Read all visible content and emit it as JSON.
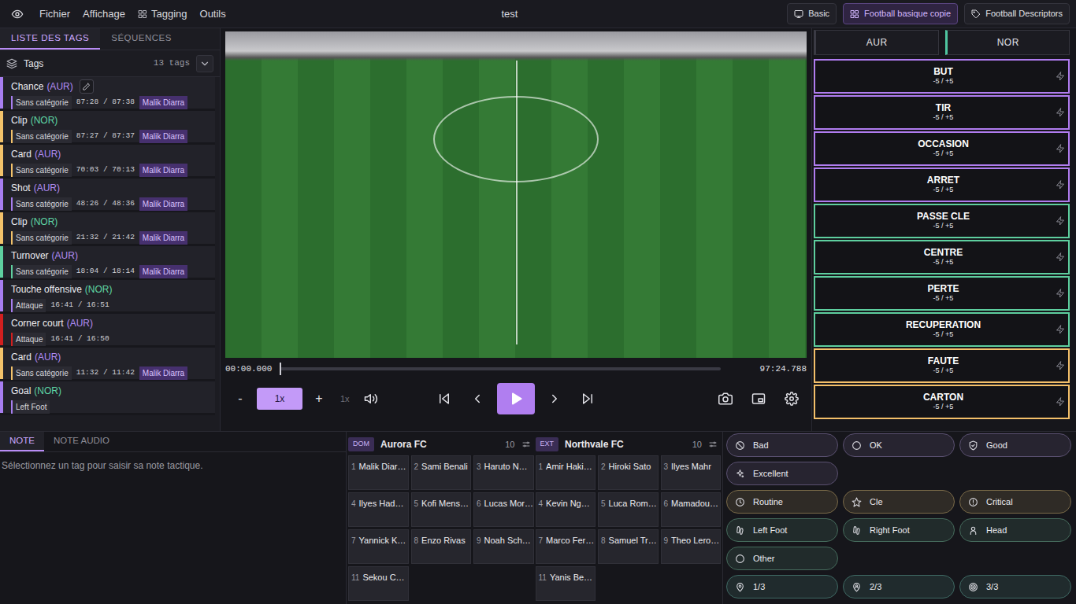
{
  "menubar": {
    "items": [
      {
        "label": "Fichier",
        "kind": "plain"
      },
      {
        "label": "Affichage",
        "kind": "plain"
      },
      {
        "label": "Tagging",
        "kind": "grid"
      },
      {
        "label": "Outils",
        "kind": "plain"
      }
    ],
    "title": "test",
    "templates": [
      {
        "label": "Basic",
        "kind": "monitor",
        "selected": false
      },
      {
        "label": "Football basique copie",
        "kind": "grid",
        "selected": true
      },
      {
        "label": "Football Descriptors",
        "kind": "tag",
        "selected": false
      }
    ]
  },
  "left_panel": {
    "tabs": [
      {
        "label": "LISTE DES TAGS",
        "selected": true
      },
      {
        "label": "SÉQUENCES",
        "selected": false
      }
    ],
    "header": {
      "title": "Tags",
      "count": "13 tags"
    },
    "tags": [
      {
        "name": "Chance",
        "team": "(AUR)",
        "team_color": "#b18cf5",
        "color": "#a77ef0",
        "editing": true,
        "category": "Sans catégorie",
        "time": "87:28 / 87:38",
        "player": "Malik Diarra"
      },
      {
        "name": "Clip",
        "team": "(NOR)",
        "team_color": "#5fd6a4",
        "color": "#f2c26a",
        "editing": false,
        "category": "Sans catégorie",
        "time": "87:27 / 87:37",
        "player": "Malik Diarra"
      },
      {
        "name": "Card",
        "team": "(AUR)",
        "team_color": "#b18cf5",
        "color": "#f2c26a",
        "editing": false,
        "category": "Sans catégorie",
        "time": "70:03 / 70:13",
        "player": "Malik Diarra"
      },
      {
        "name": "Shot",
        "team": "(AUR)",
        "team_color": "#b18cf5",
        "color": "#a77ef0",
        "editing": false,
        "category": "Sans catégorie",
        "time": "48:26 / 48:36",
        "player": "Malik Diarra"
      },
      {
        "name": "Clip",
        "team": "(NOR)",
        "team_color": "#5fd6a4",
        "color": "#f2c26a",
        "editing": false,
        "category": "Sans catégorie",
        "time": "21:32 / 21:42",
        "player": "Malik Diarra"
      },
      {
        "name": "Turnover",
        "team": "(AUR)",
        "team_color": "#b18cf5",
        "color": "#5ecf9f",
        "editing": false,
        "category": "Sans catégorie",
        "time": "18:04 / 18:14",
        "player": "Malik Diarra"
      },
      {
        "name": "Touche offensive",
        "team": "(NOR)",
        "team_color": "#5fd6a4",
        "color": "#a77ef0",
        "editing": false,
        "category": "Attaque",
        "time": "16:41 / 16:51"
      },
      {
        "name": "Corner court",
        "team": "(AUR)",
        "team_color": "#b18cf5",
        "color": "#d11f1f",
        "editing": false,
        "category": "Attaque",
        "time": "16:41 / 16:50"
      },
      {
        "name": "Card",
        "team": "(AUR)",
        "team_color": "#b18cf5",
        "color": "#f2c26a",
        "editing": false,
        "category": "Sans catégorie",
        "time": "11:32 / 11:42",
        "player": "Malik Diarra"
      },
      {
        "name": "Goal",
        "team": "(NOR)",
        "team_color": "#5fd6a4",
        "color": "#a77ef0",
        "editing": false,
        "category": "Left Foot"
      }
    ]
  },
  "player": {
    "current_time": "00:00.000",
    "duration": "97:24.788",
    "level": 0,
    "speed": {
      "minus": "-",
      "value": "1x",
      "plus": "+",
      "default": "1x"
    }
  },
  "event_panel": {
    "teams": [
      {
        "label": "AUR",
        "selected": false,
        "color": "#3a3a44"
      },
      {
        "label": "NOR",
        "selected": false,
        "color": "#4fc6a0"
      }
    ],
    "events": [
      {
        "label": "BUT",
        "range": "-5 / +5",
        "color": "#b07cf0"
      },
      {
        "label": "TIR",
        "range": "-5 / +5",
        "color": "#b07cf0"
      },
      {
        "label": "OCCASION",
        "range": "-5 / +5",
        "color": "#b07cf0"
      },
      {
        "label": "ARRET",
        "range": "-5 / +5",
        "color": "#b07cf0"
      },
      {
        "label": "PASSE CLE",
        "range": "-5 / +5",
        "color": "#5ecf9f"
      },
      {
        "label": "CENTRE",
        "range": "-5 / +5",
        "color": "#5ecf9f"
      },
      {
        "label": "PERTE",
        "range": "-5 / +5",
        "color": "#5ecf9f"
      },
      {
        "label": "RECUPERATION",
        "range": "-5 / +5",
        "color": "#5ecf9f"
      },
      {
        "label": "FAUTE",
        "range": "-5 / +5",
        "color": "#f4c06a"
      },
      {
        "label": "CARTON",
        "range": "-5 / +5",
        "color": "#f4c06a"
      }
    ]
  },
  "notes": {
    "tabs": [
      {
        "label": "NOTE",
        "selected": true
      },
      {
        "label": "NOTE AUDIO",
        "selected": false
      }
    ],
    "placeholder": "Sélectionnez un tag pour saisir sa note tactique."
  },
  "rosters": [
    {
      "side": "DOM",
      "team": "Aurora FC",
      "count": "10",
      "players": [
        {
          "number": "1",
          "name": "Malik Diar…"
        },
        {
          "number": "2",
          "name": "Sami Benali"
        },
        {
          "number": "3",
          "name": "Haruto N…"
        },
        {
          "number": "4",
          "name": "Ilyes Had…"
        },
        {
          "number": "5",
          "name": "Kofi Mens…"
        },
        {
          "number": "6",
          "name": "Lucas Mor…"
        },
        {
          "number": "7",
          "name": "Yannick K…"
        },
        {
          "number": "8",
          "name": "Enzo Rivas"
        },
        {
          "number": "9",
          "name": "Noah Sch…"
        },
        {
          "number": "11",
          "name": "Sekou C…"
        }
      ]
    },
    {
      "side": "EXT",
      "team": "Northvale FC",
      "count": "10",
      "players": [
        {
          "number": "1",
          "name": "Amir Haki…"
        },
        {
          "number": "2",
          "name": "Hiroki Sato"
        },
        {
          "number": "3",
          "name": "Ilyes Mahr"
        },
        {
          "number": "4",
          "name": "Kevin Ng…"
        },
        {
          "number": "5",
          "name": "Luca Rom…"
        },
        {
          "number": "6",
          "name": "Mamadou…"
        },
        {
          "number": "7",
          "name": "Marco Fer…"
        },
        {
          "number": "8",
          "name": "Samuel Tr…"
        },
        {
          "number": "9",
          "name": "Theo Lero…"
        },
        {
          "number": "11",
          "name": "Yanis Be…"
        }
      ]
    }
  ],
  "descriptor_groups": [
    {
      "items": [
        {
          "label": "Bad",
          "kind": "ban",
          "color": "#5a5070"
        },
        {
          "label": "OK",
          "kind": "circle",
          "color": "#5a5070"
        },
        {
          "label": "Good",
          "kind": "shield",
          "color": "#5a5070"
        },
        {
          "label": "Excellent",
          "kind": "sparkle",
          "color": "#5a5070"
        }
      ]
    },
    {
      "items": [
        {
          "label": "Routine",
          "kind": "clock",
          "color": "#7a6a48"
        },
        {
          "label": "Cle",
          "kind": "star",
          "color": "#7a6a48"
        },
        {
          "label": "Critical",
          "kind": "alert",
          "color": "#7a6a48"
        }
      ]
    },
    {
      "items": [
        {
          "label": "Left Foot",
          "kind": "foot",
          "color": "#456b5c"
        },
        {
          "label": "Right Foot",
          "kind": "foot",
          "color": "#456b5c"
        },
        {
          "label": "Head",
          "kind": "head",
          "color": "#456b5c"
        },
        {
          "label": "Other",
          "kind": "circle",
          "color": "#456b5c"
        }
      ]
    },
    {
      "items": [
        {
          "label": "1/3",
          "kind": "pin",
          "color": "#3f6a64"
        },
        {
          "label": "2/3",
          "kind": "userpin",
          "color": "#3f6a64"
        },
        {
          "label": "3/3",
          "kind": "target",
          "color": "#3f6a64"
        }
      ]
    }
  ]
}
